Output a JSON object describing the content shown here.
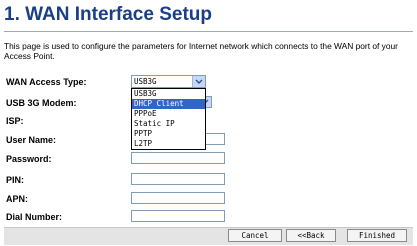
{
  "page": {
    "title": "1. WAN Interface Setup",
    "description": "This page is used to configure the parameters for Internet network which connects to the WAN port of your Access Point."
  },
  "form": {
    "wan_access_type": {
      "label": "WAN Access Type:",
      "value": "USB3G",
      "options": [
        "USB3G",
        "DHCP Client",
        "PPPoE",
        "Static IP",
        "PPTP",
        "L2TP"
      ],
      "highlighted": "DHCP Client"
    },
    "usb_3g_modem": {
      "label": "USB 3G Modem:"
    },
    "isp": {
      "label": "ISP:"
    },
    "user_name": {
      "label": "User Name:",
      "value": ""
    },
    "password": {
      "label": "Password:",
      "value": ""
    },
    "pin": {
      "label": "PIN:",
      "value": ""
    },
    "apn": {
      "label": "APN:",
      "value": ""
    },
    "dial_number": {
      "label": "Dial Number:",
      "value": ""
    }
  },
  "buttons": {
    "cancel": "Cancel",
    "back": "<<Back",
    "finished": "Finished"
  },
  "icons": {
    "dropdown_arrow": "chevron-down-icon"
  },
  "colors": {
    "title": "#1a3f86",
    "selection": "#3166c7",
    "field_border": "#7f9db9"
  }
}
